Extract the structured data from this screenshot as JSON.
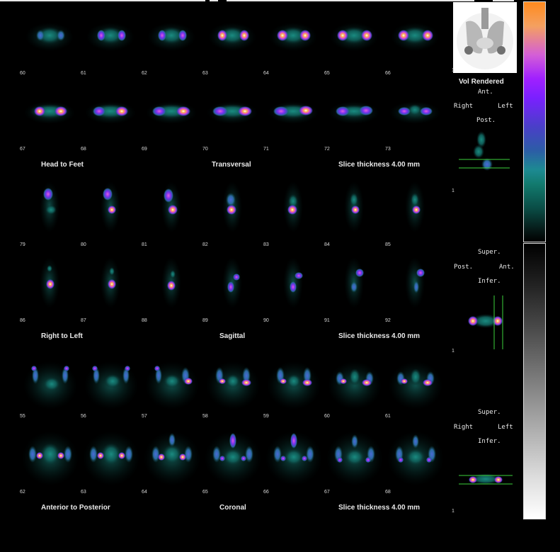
{
  "colors": {
    "background": "#000000",
    "caption": "#eaeaea"
  },
  "transversal": {
    "row1_numbers": [
      "60",
      "61",
      "62",
      "63",
      "64",
      "65",
      "66"
    ],
    "row2_numbers": [
      "67",
      "68",
      "69",
      "70",
      "71",
      "72",
      "73"
    ],
    "orientation": "Head to Feet",
    "view": "Transversal",
    "thickness": "Slice thickness 4.00 mm"
  },
  "sagittal": {
    "row1_numbers": [
      "79",
      "80",
      "81",
      "82",
      "83",
      "84",
      "85"
    ],
    "row2_numbers": [
      "86",
      "87",
      "88",
      "89",
      "90",
      "91",
      "92"
    ],
    "orientation": "Right to Left",
    "view": "Sagittal",
    "thickness": "Slice thickness 4.00 mm"
  },
  "coronal": {
    "row1_numbers": [
      "55",
      "56",
      "57",
      "58",
      "59",
      "60",
      "61"
    ],
    "row2_numbers": [
      "62",
      "63",
      "64",
      "65",
      "66",
      "67",
      "68"
    ],
    "orientation": "Anterior to Posterior",
    "view": "Coronal",
    "thickness": "Slice thickness 4.00 mm"
  },
  "side": {
    "vol_label": "Vol Rendered",
    "vol_index": "1",
    "p1": {
      "top": "Ant.",
      "left": "Right",
      "right": "Left",
      "bottom": "Post.",
      "index": "1"
    },
    "p2": {
      "top": "Super.",
      "left": "Post.",
      "right": "Ant.",
      "bottom": "Infer.",
      "index": "1"
    },
    "p3": {
      "top": "Super.",
      "left": "Right",
      "right": "Left",
      "bottom": "Infer.",
      "index": "1"
    }
  }
}
